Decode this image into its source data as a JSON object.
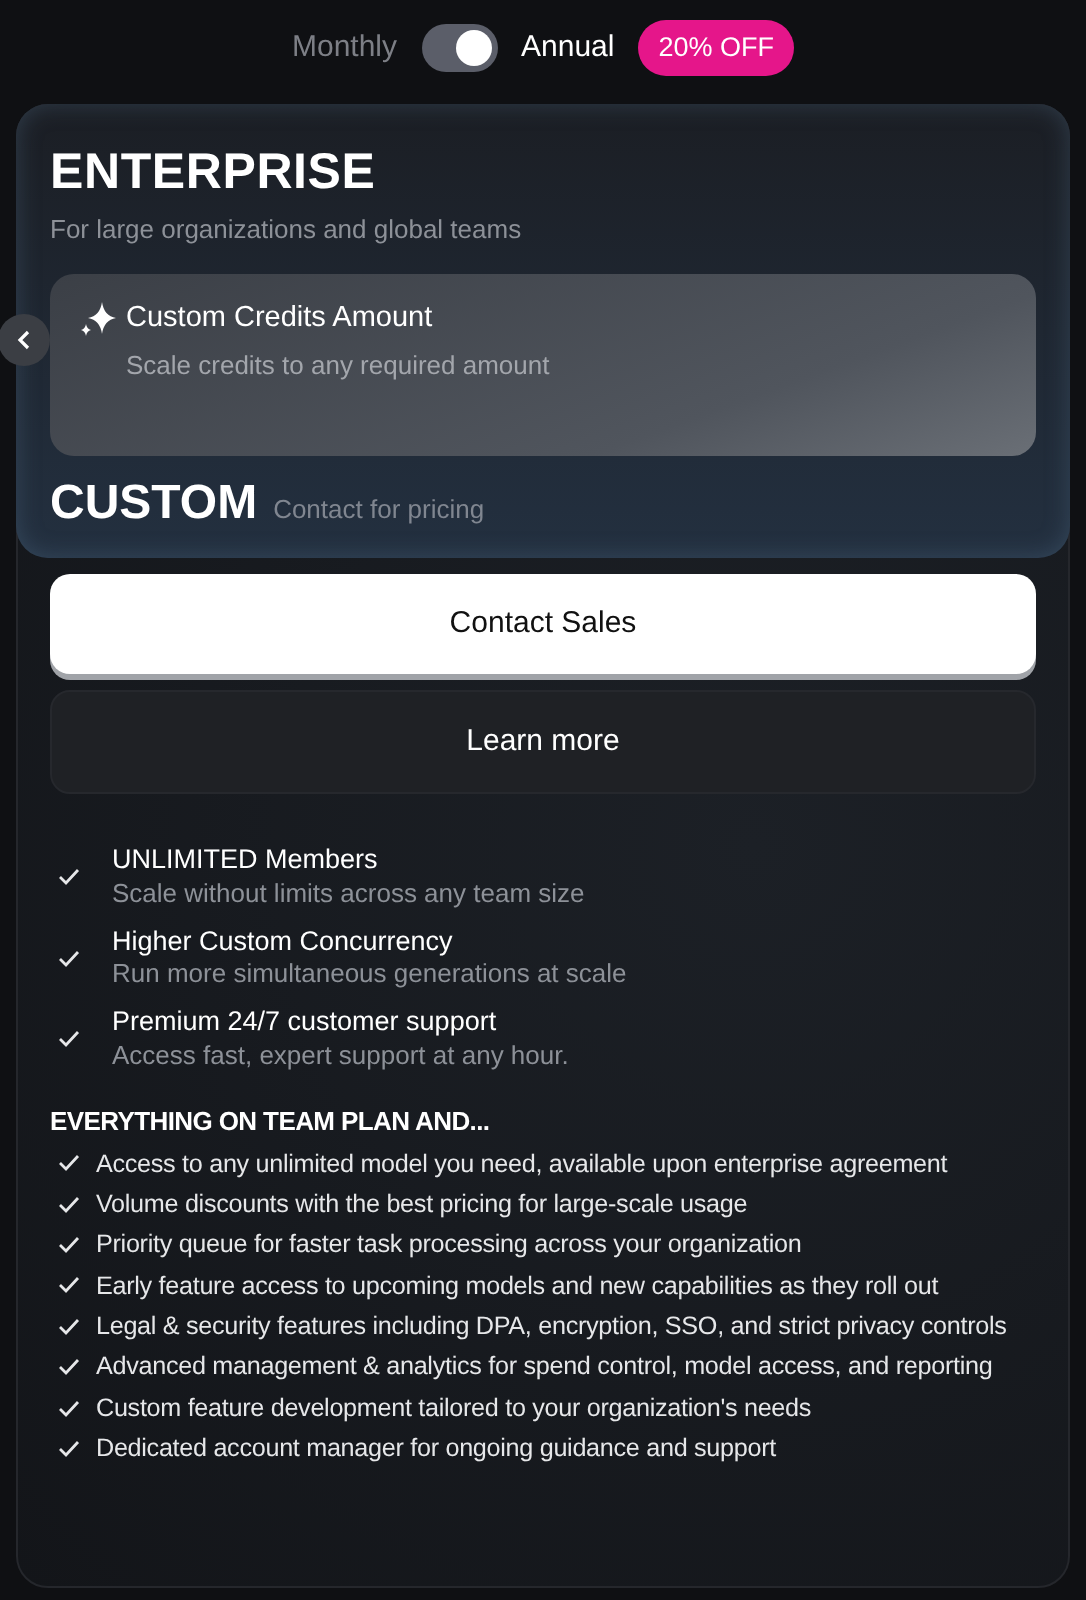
{
  "billing": {
    "options": [
      {
        "label": "Monthly",
        "selected": false
      },
      {
        "label": "Annual",
        "selected": true
      }
    ],
    "toggle_on": true,
    "discount_badge": "20% OFF"
  },
  "plan": {
    "name": "ENTERPRISE",
    "tagline": "For large organizations and global teams",
    "credits": {
      "title": "Custom Credits Amount",
      "subtitle": "Scale credits to any required amount"
    },
    "price": "CUSTOM",
    "price_note": "Contact for pricing"
  },
  "buttons": [
    {
      "label": "Contact Sales",
      "kind": "primary"
    },
    {
      "label": "Learn more",
      "kind": "secondary"
    }
  ],
  "highlights": [
    {
      "title": "UNLIMITED Members",
      "subtitle": "Scale without limits across any team size"
    },
    {
      "title": "Higher Custom Concurrency",
      "subtitle": "Run more simultaneous generations at scale"
    },
    {
      "title": "Premium 24/7 customer support",
      "subtitle": "Access fast, expert support at any hour."
    }
  ],
  "features_heading": "EVERYTHING ON TEAM PLAN AND...",
  "features": [
    "Access to any unlimited model you need, available upon enterprise agreement",
    "Volume discounts with the best pricing for large-scale usage",
    "Priority queue for faster task processing across your organization",
    "Early feature access to upcoming models and new capabilities as they roll out",
    "Legal & security features including DPA, encryption, SSO, and strict privacy controls",
    "Advanced management & analytics for spend control, model access, and reporting",
    "Custom feature development tailored to your organization's needs",
    "Dedicated account manager for ongoing guidance and support"
  ]
}
